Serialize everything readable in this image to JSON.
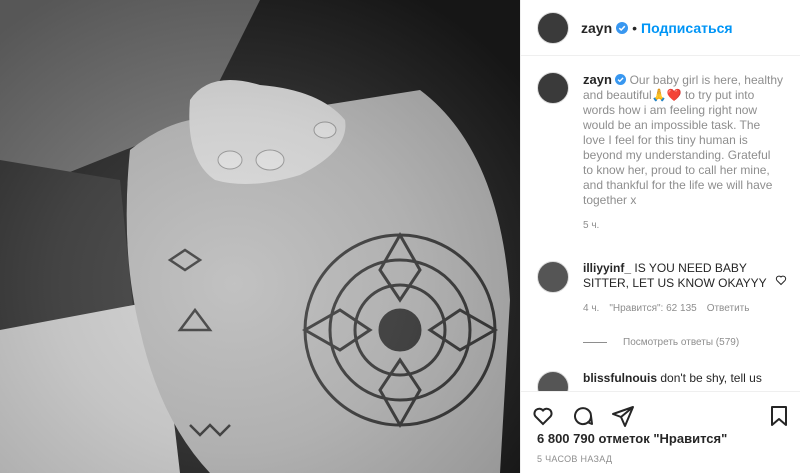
{
  "post": {
    "username": "zayn",
    "follow_label": "Подписаться",
    "dot": "•",
    "caption_text": "Our baby girl is here, healthy and beautiful🙏❤️ to try put into words how i am feeling right now would be an impossible task. The love I feel for this tiny human is beyond my understanding. Grateful to know her, proud to call her mine, and thankful for the life we will have together x",
    "caption_time": "5 ч.",
    "likes_text": "6 800 790 отметок \"Нравится\"",
    "posted_time": "5 ЧАСОВ НАЗАД"
  },
  "comments": [
    {
      "username": "illiyyinf_",
      "text": "IS YOU NEED BABY SITTER, LET US KNOW OKAYYY",
      "time": "4 ч.",
      "likes": "\"Нравится\": 62 135",
      "reply": "Ответить",
      "view_replies": "Посмотреть ответы (579)"
    },
    {
      "username": "blissfulnouis",
      "text": "don't be shy, tell us"
    }
  ],
  "icons": {
    "verified": "verified-badge-icon",
    "like": "heart-outline-icon",
    "comment": "comment-bubble-icon",
    "share": "paper-plane-icon",
    "save": "bookmark-icon"
  },
  "colors": {
    "accent": "#0095f6",
    "verified": "#3897f0",
    "heart": "#ed4956",
    "muted": "#8e8e8e",
    "text": "#262626"
  }
}
